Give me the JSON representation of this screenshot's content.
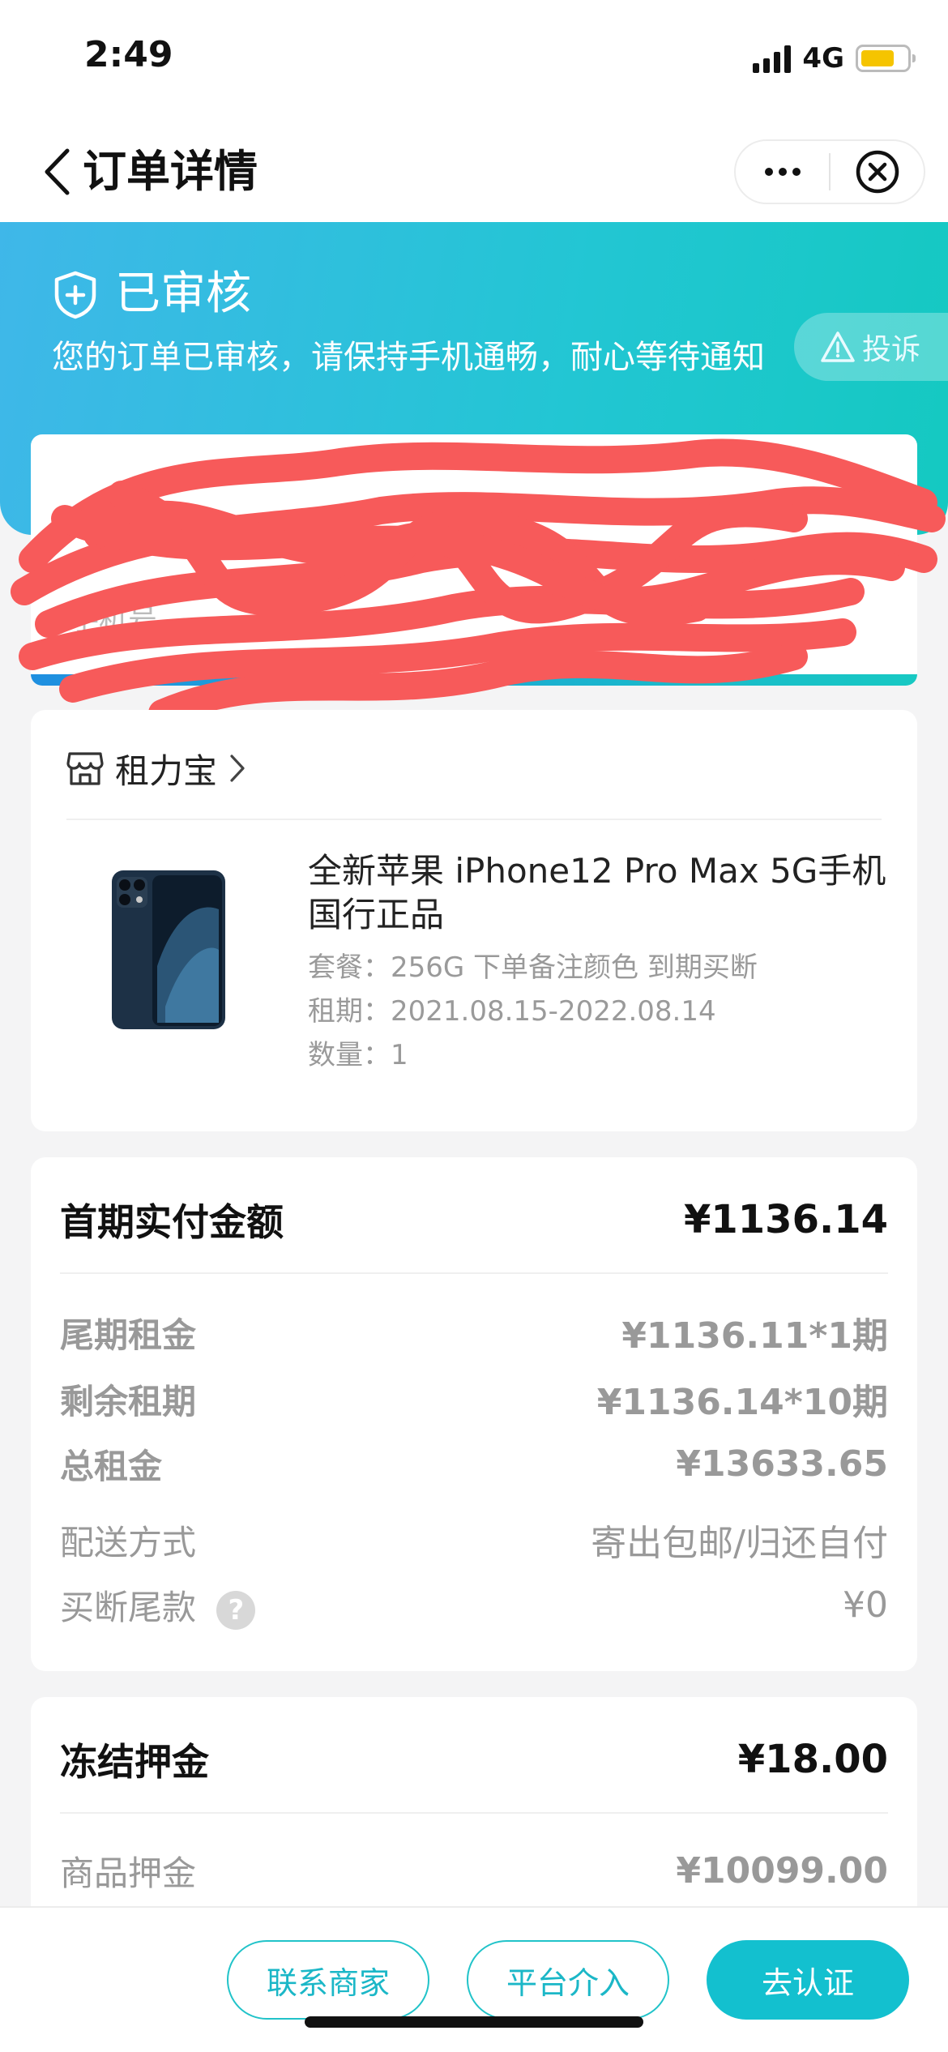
{
  "status_bar": {
    "time": "2:49",
    "network": "4G"
  },
  "nav": {
    "title": "订单详情"
  },
  "banner": {
    "title": "已审核",
    "description": "您的订单已审核，请保持手机通畅，耐心等待通知",
    "complaint_label": "投诉"
  },
  "redacted_card": {
    "visible_fragment": "手机号"
  },
  "shop": {
    "name": "租力宝"
  },
  "product": {
    "name": "全新苹果 iPhone12 Pro Max 5G手机国行正品",
    "package": "套餐：256G 下单备注颜色 到期买断",
    "lease_period": "租期：2021.08.15-2022.08.14",
    "quantity": "数量：1"
  },
  "payment": {
    "first_label": "首期实付金额",
    "first_value": "¥1136.14",
    "rows": [
      {
        "label": "尾期租金",
        "value": "¥1136.11*1期"
      },
      {
        "label": "剩余租期",
        "value": "¥1136.14*10期"
      },
      {
        "label": "总租金",
        "value": "¥13633.65"
      },
      {
        "label": "配送方式",
        "value": "寄出包邮/归还自付"
      },
      {
        "label": "买断尾款",
        "value": "¥0",
        "help": "?"
      }
    ]
  },
  "deposit": {
    "frozen_label": "冻结押金",
    "frozen_value": "¥18.00",
    "goods_label": "商品押金",
    "goods_value": "¥10099.00"
  },
  "actions": {
    "contact_merchant": "联系商家",
    "platform_intervene": "平台介入",
    "verify": "去认证"
  },
  "colors": {
    "accent": "#13c0cf",
    "banner_start": "#3fb7e9",
    "banner_end": "#14c9c1",
    "redaction": "#f75a5a"
  }
}
